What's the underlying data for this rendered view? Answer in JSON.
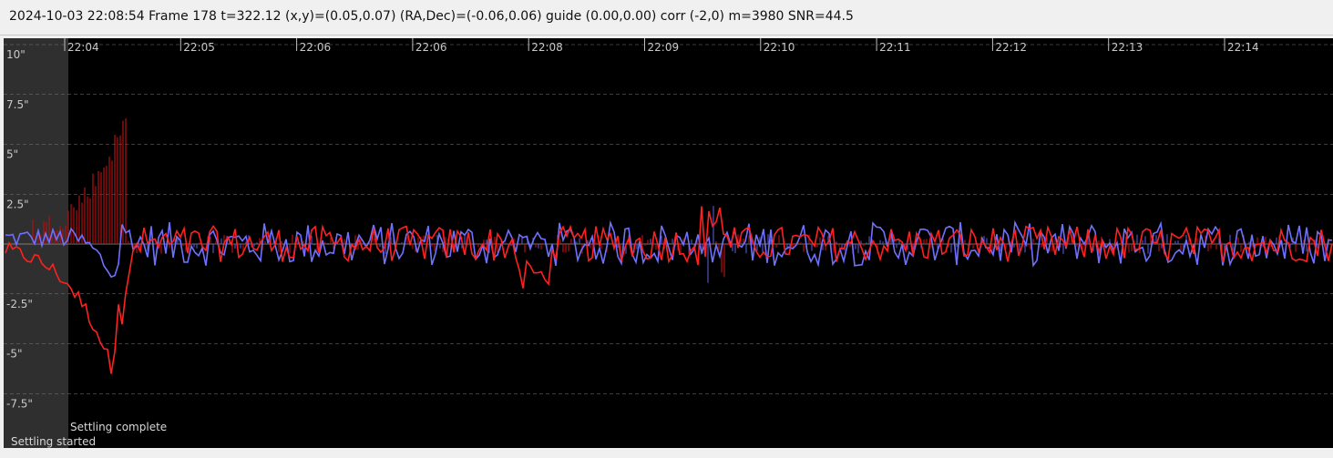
{
  "status": {
    "text": "2024-10-03 22:08:54 Frame 178 t=322.12 (x,y)=(0.05,0.07) (RA,Dec)=(-0.06,0.06) guide (0.00,0.00) corr (-2,0) m=3980 SNR=44.5"
  },
  "graph": {
    "background": "#000000",
    "grid_color": "#7a7a7a",
    "settling_band_color": "#2f2f2f",
    "ra_color": "#7070ff",
    "dec_color": "#ff2020",
    "ra_corr_color": "#5050c0",
    "dec_corr_color": "#b01010",
    "y_labels": [
      "10\"",
      "7.5\"",
      "5\"",
      "2.5\"",
      "-2.5\"",
      "-5\"",
      "-7.5\""
    ],
    "y_values": [
      10,
      7.5,
      5,
      2.5,
      -2.5,
      -5,
      -7.5
    ],
    "x_labels": [
      "22:04",
      "22:05",
      "22:06",
      "22:06",
      "22:08",
      "22:09",
      "22:10",
      "22:11",
      "22:12",
      "22:13",
      "22:14"
    ],
    "events": {
      "settling_started": "Settling started",
      "settling_complete": "Settling complete"
    }
  }
}
